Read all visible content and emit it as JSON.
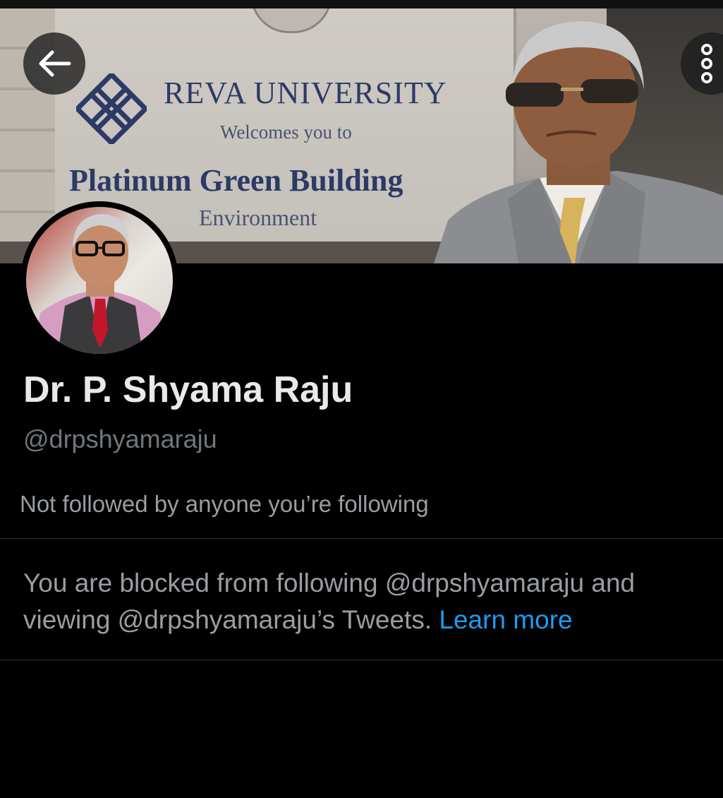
{
  "header": {
    "back_icon": "arrow-left-icon",
    "more_icon": "more-vertical-icon"
  },
  "banner": {
    "sign_title": "REVA UNIVERSITY",
    "sign_sub": "Welcomes you to",
    "sign_building": "Platinum Green Building",
    "sign_env": "Environment"
  },
  "profile": {
    "display_name": "Dr. P. Shyama Raju",
    "handle": "@drpshyamaraju",
    "followers_note": "Not followed by anyone you’re following"
  },
  "blocked": {
    "message": "You are blocked from following @drpshyamaraju and viewing @drpshyamaraju’s Tweets.",
    "link_label": "Learn more"
  },
  "colors": {
    "background": "#000000",
    "link": "#1d9bf0",
    "secondary_text": "#71767b",
    "primary_text": "#e7e9ea"
  }
}
